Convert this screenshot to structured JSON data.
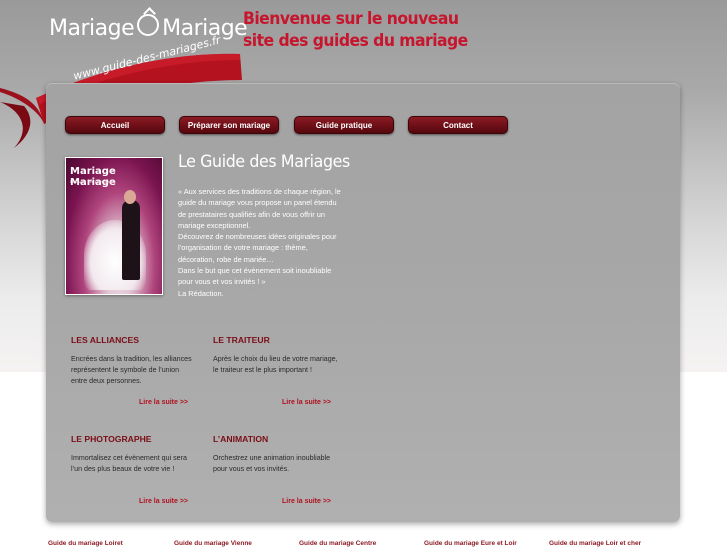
{
  "header": {
    "logo_left": "Mariage",
    "logo_right": "Mariage",
    "welcome_line1": "Bienvenue sur le nouveau",
    "welcome_line2": "site des guides du mariage",
    "ribbon_url": "www.guide-des-mariages.fr"
  },
  "nav": {
    "items": [
      "Accueil",
      "Préparer son mariage",
      "Guide pratique",
      "Contact"
    ]
  },
  "magazine": {
    "title": "Mariage Mariage",
    "subtitle": "Le Guide des Mariages"
  },
  "intro": {
    "title": "Le Guide des Mariages",
    "p1": "« Aux services des traditions de chaque région, le guide du mariage vous propose un panel étendu de prestataires qualifiés afin de vous offrir un mariage exceptionnel.",
    "p2": "Découvrez de nombreuses idées originales pour l’organisation de votre mariage : thème, décoration, robe de mariée…",
    "p3": "Dans le but que cet évènement soit inoubliable pour vous et vos invités ! »",
    "p4": "La Rédaction."
  },
  "cards": [
    {
      "title": "LES ALLIANCES",
      "text": "Encrées dans la tradition, les alliances représentent le symbole de l’union entre deux personnes.",
      "more": "Lire la suite >>"
    },
    {
      "title": "LE TRAITEUR",
      "text": "Après le choix du lieu de votre mariage, le traiteur est le plus important !",
      "more": "Lire la suite >>"
    },
    {
      "title": "LE PHOTOGRAPHE",
      "text": "Immortalisez cet évènement qui sera l’un des plus beaux de votre vie !",
      "more": "Lire la suite >>"
    },
    {
      "title": "L’ANIMATION",
      "text": "Orchestrez une animation inoubliable pour vous et vos invités.",
      "more": "Lire la suite >>"
    }
  ],
  "footer": {
    "links": [
      "Guide du mariage Loiret",
      "Guide du mariage Vienne",
      "Guide du mariage Centre",
      "Guide du mariage Eure et Loir",
      "Guide du mariage Loir et cher"
    ]
  },
  "colors": {
    "accent": "#c6152c",
    "nav_button": "#6e0f17",
    "card_title": "#7b0d16"
  }
}
